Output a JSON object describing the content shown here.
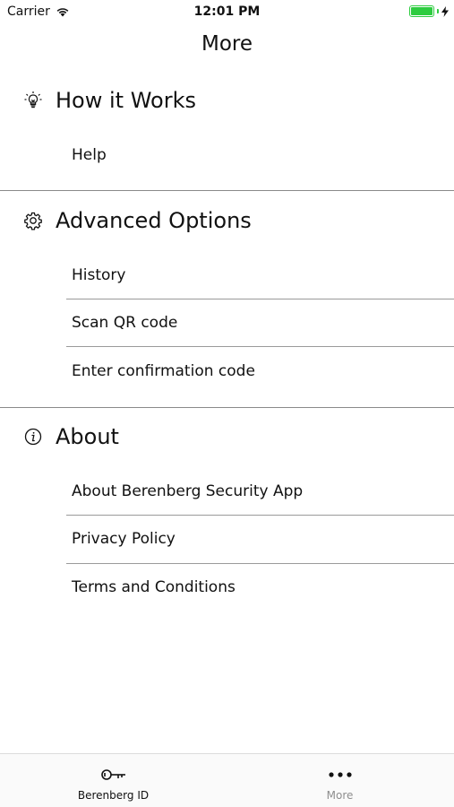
{
  "status_bar": {
    "carrier": "Carrier",
    "time": "12:01 PM"
  },
  "nav": {
    "title": "More"
  },
  "sections": [
    {
      "title": "How it Works",
      "icon": "lightbulb-icon",
      "items": [
        "Help"
      ]
    },
    {
      "title": "Advanced Options",
      "icon": "gear-icon",
      "items": [
        "History",
        "Scan QR code",
        "Enter confirmation code"
      ]
    },
    {
      "title": "About",
      "icon": "info-icon",
      "items": [
        "About Berenberg Security App",
        "Privacy Policy",
        "Terms and Conditions"
      ]
    }
  ],
  "tab_bar": {
    "tabs": [
      {
        "label": "Berenberg ID",
        "icon": "key-icon",
        "active": true
      },
      {
        "label": "More",
        "icon": "more-dots-icon",
        "active": false
      }
    ]
  },
  "colors": {
    "battery": "#2ecc40",
    "separator": "#9a9a9a",
    "inactive_tab": "#8e8e8e"
  }
}
